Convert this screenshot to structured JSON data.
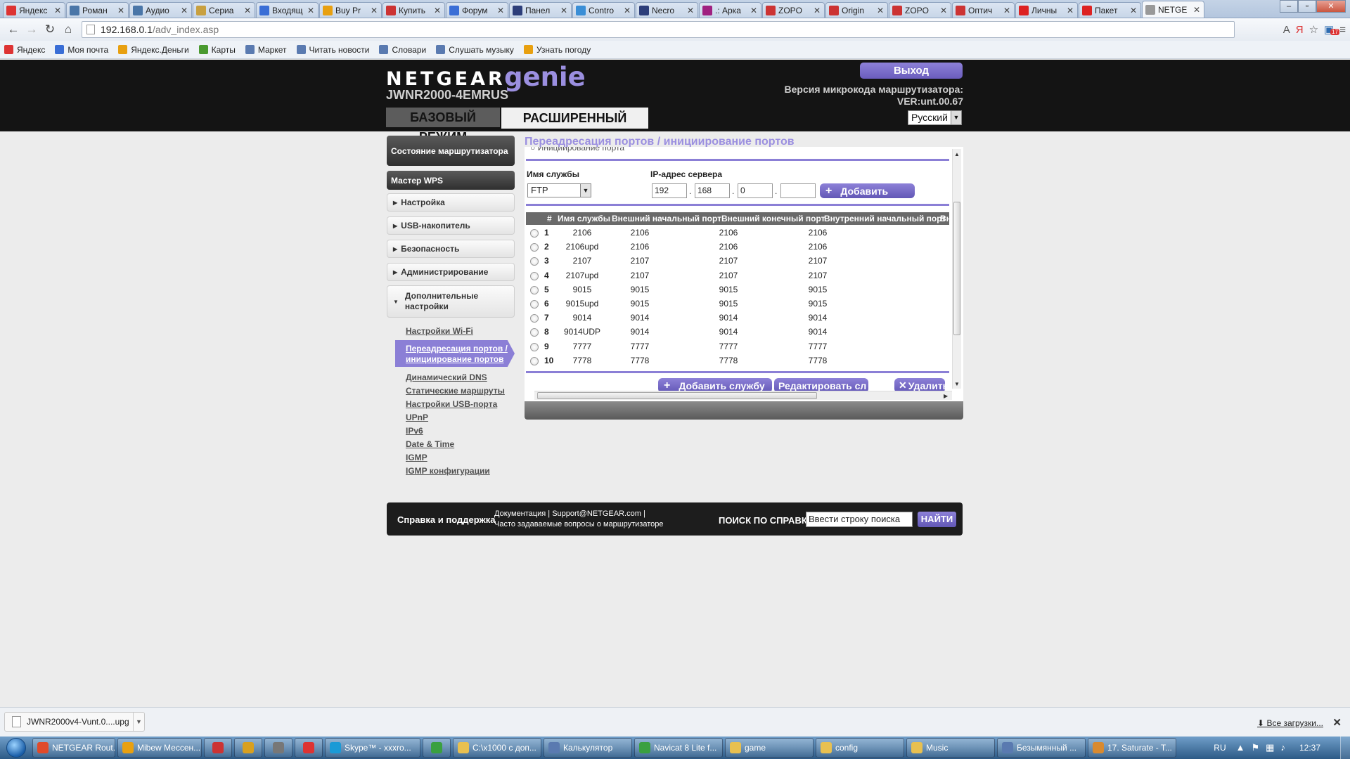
{
  "browser": {
    "tabs": [
      {
        "label": "Яндекс",
        "icon": "yandex-icon",
        "color": "#d33"
      },
      {
        "label": "Роман",
        "icon": "vk-icon",
        "color": "#4a76a8"
      },
      {
        "label": "Аудио",
        "icon": "vk-icon",
        "color": "#4a76a8"
      },
      {
        "label": "Сериа",
        "icon": "tv-icon",
        "color": "#c8a040"
      },
      {
        "label": "Входящ",
        "icon": "mail-icon",
        "color": "#3a6ed6"
      },
      {
        "label": "Buy Pr",
        "icon": "shop-icon",
        "color": "#e8a010"
      },
      {
        "label": "Купить",
        "icon": "shop-icon",
        "color": "#c33"
      },
      {
        "label": "Форум",
        "icon": "forum-icon",
        "color": "#3a6ed6"
      },
      {
        "label": "Панел",
        "icon": "panel-icon",
        "color": "#2d3e7a"
      },
      {
        "label": "Contro",
        "icon": "control-icon",
        "color": "#3a8ed6"
      },
      {
        "label": "Necro",
        "icon": "necro-icon",
        "color": "#2d3e7a"
      },
      {
        "label": ".: Арка",
        "icon": "arcade-icon",
        "color": "#a02080"
      },
      {
        "label": "ZOPO",
        "icon": "shop-icon",
        "color": "#c33"
      },
      {
        "label": "Origin",
        "icon": "shop-icon",
        "color": "#c33"
      },
      {
        "label": "ZOPO",
        "icon": "shop-icon",
        "color": "#c33"
      },
      {
        "label": "Оптич",
        "icon": "shop-icon",
        "color": "#c33"
      },
      {
        "label": "Личны",
        "icon": "youtube-icon",
        "color": "#d22"
      },
      {
        "label": "Пакет",
        "icon": "youtube-icon",
        "color": "#d22"
      },
      {
        "label": "NETGE",
        "icon": "page-icon",
        "color": "#999",
        "active": true
      }
    ],
    "tab_close": "✕",
    "url_host": "192.168.0.1",
    "url_path": "/adv_index.asp",
    "badge_count": "17",
    "bookmarks": [
      {
        "label": "Яндекс",
        "color": "#d33"
      },
      {
        "label": "Моя почта",
        "color": "#3a6ed6"
      },
      {
        "label": "Яндекс.Деньги",
        "color": "#e8a010"
      },
      {
        "label": "Карты",
        "color": "#4a9a30"
      },
      {
        "label": "Маркет",
        "color": "#5a7ab0"
      },
      {
        "label": "Читать новости",
        "color": "#5a7ab0"
      },
      {
        "label": "Словари",
        "color": "#5a7ab0"
      },
      {
        "label": "Слушать музыку",
        "color": "#5a7ab0"
      },
      {
        "label": "Узнать погоду",
        "color": "#e8a010"
      }
    ]
  },
  "header": {
    "brand": "NETGEAR",
    "genie": "genie",
    "model": "JWNR2000-4EMRUS",
    "tab_basic": "БАЗОВЫЙ РЕЖИМ",
    "tab_advanced": "РАСШИРЕННЫЙ",
    "logout": "Выход",
    "firmware_label": "Версия микрокода маршрутизатора:",
    "firmware_version": "VER:unt.00.67",
    "language": "Русский"
  },
  "menu": {
    "router_status": "Состояние маршрутизатора",
    "wps_wizard": "Мастер WPS",
    "setup": "Настройка",
    "usb_storage": "USB-накопитель",
    "security": "Безопасность",
    "administration": "Администрирование",
    "advanced_setup": "Дополнительные настройки",
    "sub": [
      "Настройки Wi-Fi",
      "Переадресация портов / инициирование портов",
      "Динамический DNS",
      "Статические маршруты",
      "Настройки USB-порта",
      "UPnP",
      "IPv6",
      "Date & Time",
      "IGMP",
      "IGMP конфигурации"
    ]
  },
  "main": {
    "title": "Переадресация портов / инициирование портов",
    "cut_option": "Инициирование порта",
    "service_name_label": "Имя службы",
    "server_ip_label": "IP-адрес сервера",
    "service_selected": "FTP",
    "ip": [
      "192",
      "168",
      "0",
      ""
    ],
    "add_button": "Добавить",
    "columns": [
      "#",
      "Имя службы",
      "Внешний начальный порт",
      "Внешний конечный порт",
      "Внутренний начальный порт",
      "Вн"
    ],
    "rows": [
      {
        "n": "1",
        "service": "2106",
        "ext_start": "2106",
        "ext_end": "2106",
        "int_start": "2106"
      },
      {
        "n": "2",
        "service": "2106upd",
        "ext_start": "2106",
        "ext_end": "2106",
        "int_start": "2106"
      },
      {
        "n": "3",
        "service": "2107",
        "ext_start": "2107",
        "ext_end": "2107",
        "int_start": "2107"
      },
      {
        "n": "4",
        "service": "2107upd",
        "ext_start": "2107",
        "ext_end": "2107",
        "int_start": "2107"
      },
      {
        "n": "5",
        "service": "9015",
        "ext_start": "9015",
        "ext_end": "9015",
        "int_start": "9015"
      },
      {
        "n": "6",
        "service": "9015upd",
        "ext_start": "9015",
        "ext_end": "9015",
        "int_start": "9015"
      },
      {
        "n": "7",
        "service": "9014",
        "ext_start": "9014",
        "ext_end": "9014",
        "int_start": "9014"
      },
      {
        "n": "8",
        "service": "9014UDP",
        "ext_start": "9014",
        "ext_end": "9014",
        "int_start": "9014"
      },
      {
        "n": "9",
        "service": "7777",
        "ext_start": "7777",
        "ext_end": "7777",
        "int_start": "7777"
      },
      {
        "n": "10",
        "service": "7778",
        "ext_start": "7778",
        "ext_end": "7778",
        "int_start": "7778"
      }
    ],
    "add_service_button": "Добавить службу",
    "edit_service_button": "Редактировать сл",
    "delete_button": "Удалить"
  },
  "help": {
    "title": "Справка и поддержка",
    "documentation": "Документация",
    "support": "Support@NETGEAR.com",
    "faq": "Часто задаваемые вопросы о маршрутизаторе",
    "search_label": "ПОИСК ПО СПРАВКЕ",
    "search_placeholder": "Ввести строку поиска",
    "search_button": "НАЙТИ"
  },
  "downloads": {
    "file": "JWNR2000v4-Vunt.0....upg",
    "all_downloads": "Все загрузки..."
  },
  "taskbar": {
    "items": [
      {
        "label": "NETGEAR Rout...",
        "color": "#e04a2a",
        "icon": "chrome-icon"
      },
      {
        "label": "Mibew Мессен...",
        "color": "#e8a010",
        "icon": "firefox-icon"
      },
      {
        "label": "",
        "color": "#c33",
        "icon": "app-icon"
      },
      {
        "label": "",
        "color": "#d8a020",
        "icon": "app-icon"
      },
      {
        "label": "",
        "color": "#777",
        "icon": "app-icon"
      },
      {
        "label": "",
        "color": "#d33",
        "icon": "yandex-icon"
      },
      {
        "label": "Skype™ - xxxro...",
        "color": "#1a9ad6",
        "icon": "skype-icon"
      },
      {
        "label": "",
        "color": "#3aa040",
        "icon": "app-icon"
      },
      {
        "label": "C:\\x1000 с доп...",
        "color": "#e8c050",
        "icon": "notepad-icon"
      },
      {
        "label": "Калькулятор",
        "color": "#5a7ab0",
        "icon": "calculator-icon"
      },
      {
        "label": "Navicat 8 Lite f...",
        "color": "#3aa040",
        "icon": "navicat-icon"
      },
      {
        "label": "game",
        "color": "#e8c050",
        "icon": "folder-icon"
      },
      {
        "label": "config",
        "color": "#e8c050",
        "icon": "folder-icon"
      },
      {
        "label": "Music",
        "color": "#e8c050",
        "icon": "folder-icon"
      },
      {
        "label": "Безымянный ...",
        "color": "#5a7ab0",
        "icon": "paint-icon"
      },
      {
        "label": "17. Saturate - T...",
        "color": "#d88a30",
        "icon": "player-icon"
      }
    ],
    "lang": "RU",
    "clock": "12:37"
  }
}
